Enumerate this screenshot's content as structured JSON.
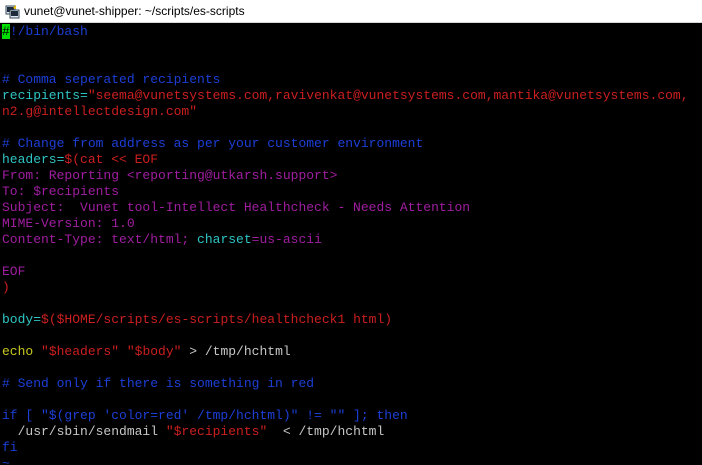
{
  "window": {
    "title": "vunet@vunet-shipper: ~/scripts/es-scripts",
    "icon": "putty-terminal-icon"
  },
  "colors": {
    "background": "#000000",
    "cursor": "#00e000",
    "comment": "#1c3fd8",
    "variable": "#2fc4c4",
    "string": "#cc1f1f",
    "header_text": "#a01ea0",
    "command": "#c8c820",
    "plain": "#c6c6c6"
  },
  "editor": {
    "lines": [
      {
        "line": 1,
        "segments": [
          {
            "t": "#",
            "c": "cursor"
          },
          {
            "t": "!/bin/bash",
            "c": "comment"
          }
        ]
      },
      {
        "line": 2,
        "segments": []
      },
      {
        "line": 3,
        "segments": []
      },
      {
        "line": 4,
        "segments": [
          {
            "t": "# Comma seperated recipients",
            "c": "comment"
          }
        ]
      },
      {
        "line": 5,
        "segments": [
          {
            "t": "recipients=",
            "c": "var"
          },
          {
            "t": "\"seema@vunetsystems.com,ravivenkat@vunetsystems.com,mantika@vunetsystems.com,",
            "c": "str"
          }
        ]
      },
      {
        "line": 6,
        "segments": [
          {
            "t": "n2.g@intellectdesign.com\"",
            "c": "str"
          }
        ]
      },
      {
        "line": 7,
        "segments": []
      },
      {
        "line": 8,
        "segments": [
          {
            "t": "# Change from address as per your customer environment",
            "c": "comment"
          }
        ]
      },
      {
        "line": 9,
        "segments": [
          {
            "t": "headers=",
            "c": "var"
          },
          {
            "t": "$(cat << EOF",
            "c": "str"
          }
        ]
      },
      {
        "line": 10,
        "segments": [
          {
            "t": "From: Reporting <reporting@utkarsh.support>",
            "c": "head"
          }
        ]
      },
      {
        "line": 11,
        "segments": [
          {
            "t": "To: $recipients",
            "c": "head"
          }
        ]
      },
      {
        "line": 12,
        "segments": [
          {
            "t": "Subject:  Vunet tool-Intellect Healthcheck - Needs Attention",
            "c": "head"
          }
        ]
      },
      {
        "line": 13,
        "segments": [
          {
            "t": "MIME-Version: 1.0",
            "c": "head"
          }
        ]
      },
      {
        "line": 14,
        "segments": [
          {
            "t": "Content-Type: text/html; ",
            "c": "head"
          },
          {
            "t": "charset",
            "c": "var"
          },
          {
            "t": "=us-ascii",
            "c": "head"
          }
        ]
      },
      {
        "line": 15,
        "segments": []
      },
      {
        "line": 16,
        "segments": [
          {
            "t": "EOF",
            "c": "head"
          }
        ]
      },
      {
        "line": 17,
        "segments": [
          {
            "t": ")",
            "c": "str"
          }
        ]
      },
      {
        "line": 18,
        "segments": []
      },
      {
        "line": 19,
        "segments": [
          {
            "t": "body=",
            "c": "var"
          },
          {
            "t": "$($HOME/scripts/es-scripts/healthcheck1 html)",
            "c": "str"
          }
        ]
      },
      {
        "line": 20,
        "segments": []
      },
      {
        "line": 21,
        "segments": [
          {
            "t": "echo ",
            "c": "cmd"
          },
          {
            "t": "\"$headers\"",
            "c": "str"
          },
          {
            "t": " ",
            "c": "plain"
          },
          {
            "t": "\"$body\"",
            "c": "str"
          },
          {
            "t": " > /tmp/hchtml",
            "c": "plain"
          }
        ]
      },
      {
        "line": 22,
        "segments": []
      },
      {
        "line": 23,
        "segments": [
          {
            "t": "# Send only if there is something in red",
            "c": "comment"
          }
        ]
      },
      {
        "line": 24,
        "segments": []
      },
      {
        "line": 25,
        "segments": [
          {
            "t": "if [ \"$(grep 'color=red' /tmp/hchtml)\" != \"\" ]; then",
            "c": "kw"
          }
        ]
      },
      {
        "line": 26,
        "segments": [
          {
            "t": "  /usr/sbin/sendmail ",
            "c": "plain"
          },
          {
            "t": "\"$recipients\"",
            "c": "str"
          },
          {
            "t": "  < /tmp/hchtml",
            "c": "plain"
          }
        ]
      },
      {
        "line": 27,
        "segments": [
          {
            "t": "fi",
            "c": "kw"
          }
        ]
      },
      {
        "line": 28,
        "segments": [
          {
            "t": "~",
            "c": "tilde"
          }
        ]
      }
    ]
  }
}
